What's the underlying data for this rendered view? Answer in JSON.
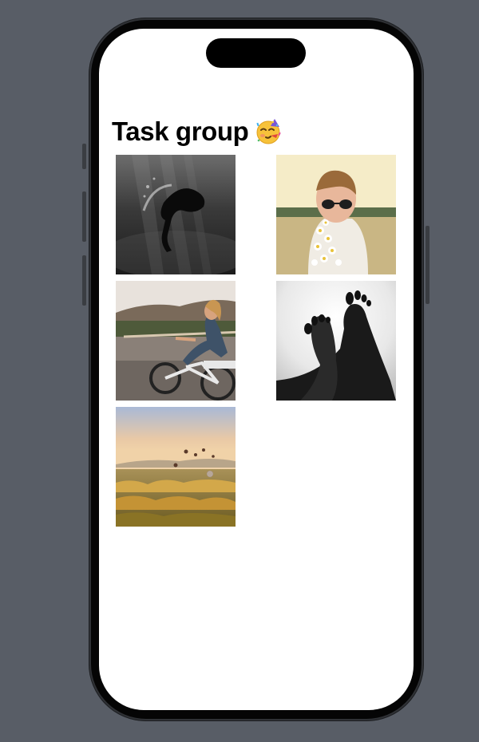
{
  "screen": {
    "title": "Task group",
    "title_emoji": "partying-face-emoji"
  },
  "photos": [
    {
      "icon": "underwater-diver-photo"
    },
    {
      "icon": "woman-sunglasses-flowers-photo"
    },
    {
      "icon": "woman-bicycle-photo"
    },
    {
      "icon": "bare-feet-photo"
    },
    {
      "icon": "hot-air-balloons-valley-photo"
    }
  ],
  "colors": {
    "background": "#585d66",
    "screen": "#ffffff",
    "frame": "#050505"
  }
}
